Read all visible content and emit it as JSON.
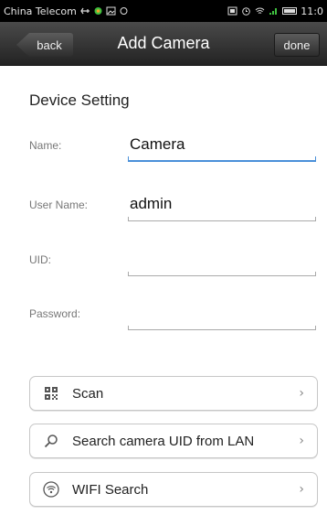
{
  "status_bar": {
    "carrier": "China Telecom",
    "time": "11:0"
  },
  "nav": {
    "title": "Add Camera",
    "back_label": "back",
    "done_label": "done"
  },
  "section_title": "Device Setting",
  "fields": [
    {
      "label": "Name:",
      "value": "Camera",
      "placeholder": ""
    },
    {
      "label": "User Name:",
      "value": "admin",
      "placeholder": ""
    },
    {
      "label": "UID:",
      "value": "",
      "placeholder": ""
    },
    {
      "label": "Password:",
      "value": "",
      "placeholder": ""
    }
  ],
  "actions": [
    {
      "label": "Scan",
      "icon": "qr-code-icon"
    },
    {
      "label": "Search camera UID from LAN",
      "icon": "search-icon"
    },
    {
      "label": "WIFI Search",
      "icon": "wifi-icon"
    }
  ]
}
